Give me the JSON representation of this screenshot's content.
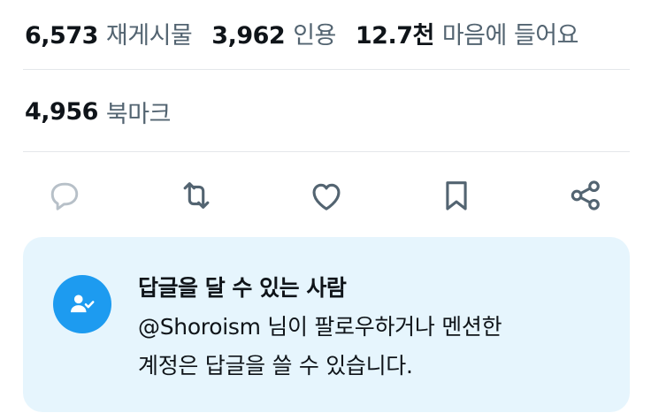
{
  "stats": {
    "reposts": {
      "count": "6,573",
      "label": "재게시물"
    },
    "quotes": {
      "count": "3,962",
      "label": "인용"
    },
    "likes": {
      "count": "12.7천",
      "label": "마음에 들어요"
    },
    "bookmarks": {
      "count": "4,956",
      "label": "북마크"
    }
  },
  "actions": {
    "reply_icon": "reply-icon",
    "retweet_icon": "retweet-icon",
    "like_icon": "heart-icon",
    "bookmark_icon": "bookmark-icon",
    "share_icon": "share-icon"
  },
  "reply_restriction": {
    "title": "답글을 달 수 있는 사람",
    "line1": "@Shoroism 님이 팔로우하거나 멘션한",
    "line2": "계정은 답글을 쓸 수 있습니다."
  },
  "colors": {
    "accent": "#1d9bf0",
    "muted_text": "#536471",
    "icon_gray": "#536471",
    "panel_bg": "#e6f5fd"
  }
}
